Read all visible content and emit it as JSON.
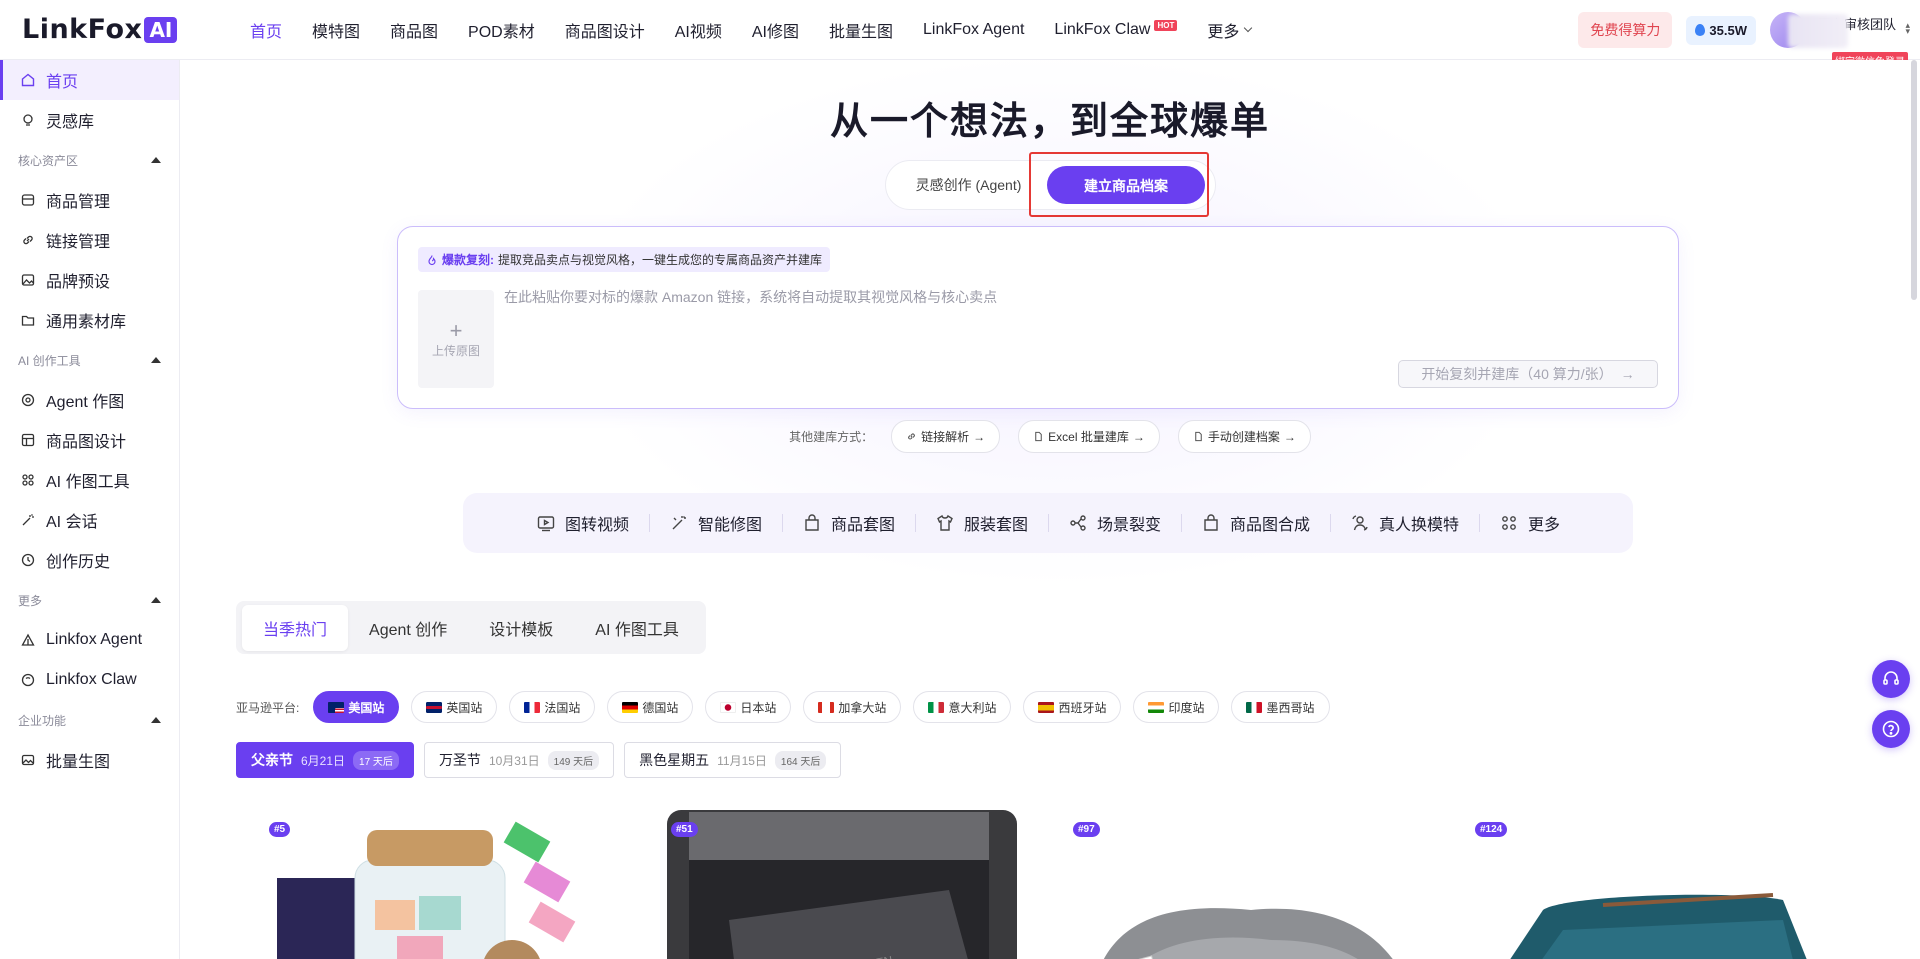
{
  "logo": {
    "text": "LinkFox",
    "badge": "AI"
  },
  "nav": {
    "items": [
      {
        "label": "首页",
        "active": true
      },
      {
        "label": "模特图"
      },
      {
        "label": "商品图"
      },
      {
        "label": "POD素材"
      },
      {
        "label": "商品图设计"
      },
      {
        "label": "AI视频"
      },
      {
        "label": "AI修图"
      },
      {
        "label": "批量生图"
      },
      {
        "label": "LinkFox Agent"
      },
      {
        "label": "LinkFox Claw",
        "badge": "HOT"
      },
      {
        "label": "更多"
      }
    ],
    "free_label": "免费得算力",
    "power_value": "35.5W",
    "team_name": "平台审核团队",
    "bind_tag": "绑定微信免登录"
  },
  "sidebar": {
    "top_items": [
      {
        "label": "首页",
        "icon": "home-icon",
        "active": true
      },
      {
        "label": "灵感库",
        "icon": "lightbulb-icon"
      }
    ],
    "groups": [
      {
        "title": "核心资产区",
        "items": [
          {
            "label": "商品管理",
            "icon": "box-icon"
          },
          {
            "label": "链接管理",
            "icon": "link-icon"
          },
          {
            "label": "品牌预设",
            "icon": "image-frame-icon"
          },
          {
            "label": "通用素材库",
            "icon": "folder-icon"
          }
        ]
      },
      {
        "title": "AI 创作工具",
        "items": [
          {
            "label": "Agent 作图",
            "icon": "agent-icon"
          },
          {
            "label": "商品图设计",
            "icon": "layout-icon"
          },
          {
            "label": "AI 作图工具",
            "icon": "grid-dots-icon"
          },
          {
            "label": "AI 会话",
            "icon": "magic-wand-icon"
          },
          {
            "label": "创作历史",
            "icon": "history-icon"
          }
        ]
      },
      {
        "title": "更多",
        "items": [
          {
            "label": "Linkfox Agent",
            "icon": "triangle-icon"
          },
          {
            "label": "Linkfox Claw",
            "icon": "claw-icon"
          }
        ]
      },
      {
        "title": "企业功能",
        "items": [
          {
            "label": "批量生图",
            "icon": "gallery-icon"
          }
        ]
      }
    ]
  },
  "hero": {
    "title": "从一个想法，到全球爆单",
    "mode_inactive": "灵感创作 (Agent)",
    "mode_active": "建立商品档案"
  },
  "panel": {
    "tag_key": "爆款复刻:",
    "tag_desc": "提取竞品卖点与视觉风格，一键生成您的专属商品资产并建库",
    "upload_label": "上传原图",
    "input_placeholder": "在此粘贴你要对标的爆款 Amazon 链接，系统将自动提取其视觉风格与核心卖点",
    "start_button": "开始复刻并建库（40 算力/张）"
  },
  "other_methods": {
    "label": "其他建库方式：",
    "items": [
      "链接解析",
      "Excel 批量建库",
      "手动创建档案"
    ]
  },
  "tools": [
    {
      "label": "图转视频",
      "icon": "video-icon"
    },
    {
      "label": "智能修图",
      "icon": "retouch-icon"
    },
    {
      "label": "商品套图",
      "icon": "bag-icon"
    },
    {
      "label": "服装套图",
      "icon": "shirt-icon"
    },
    {
      "label": "场景裂变",
      "icon": "split-icon"
    },
    {
      "label": "商品图合成",
      "icon": "bag-icon"
    },
    {
      "label": "真人换模特",
      "icon": "swap-person-icon"
    },
    {
      "label": "更多",
      "icon": "grid-dots-icon"
    }
  ],
  "content_tabs": [
    {
      "label": "当季热门",
      "active": true
    },
    {
      "label": "Agent 创作"
    },
    {
      "label": "设计模板"
    },
    {
      "label": "AI 作图工具"
    }
  ],
  "platform": {
    "label": "亚马逊平台:",
    "sites": [
      {
        "label": "美国站",
        "flag": "us",
        "active": true
      },
      {
        "label": "英国站",
        "flag": "uk"
      },
      {
        "label": "法国站",
        "flag": "fr"
      },
      {
        "label": "德国站",
        "flag": "de"
      },
      {
        "label": "日本站",
        "flag": "jp"
      },
      {
        "label": "加拿大站",
        "flag": "ca"
      },
      {
        "label": "意大利站",
        "flag": "it"
      },
      {
        "label": "西班牙站",
        "flag": "es"
      },
      {
        "label": "印度站",
        "flag": "in"
      },
      {
        "label": "墨西哥站",
        "flag": "mx"
      }
    ]
  },
  "holidays": [
    {
      "name": "父亲节",
      "date": "6月21日",
      "days": "17 天后",
      "active": true
    },
    {
      "name": "万圣节",
      "date": "10月31日",
      "days": "149 天后"
    },
    {
      "name": "黑色星期五",
      "date": "11月15日",
      "days": "164 天后"
    }
  ],
  "cards": [
    {
      "rank": "#5",
      "subject": "jar-gift"
    },
    {
      "rank": "#51",
      "subject": "car-console"
    },
    {
      "rank": "#97",
      "subject": "blanket"
    },
    {
      "rank": "#124",
      "subject": "wallet"
    }
  ],
  "colors": {
    "accent": "#6a3ff0",
    "highlight": "#e53935"
  }
}
